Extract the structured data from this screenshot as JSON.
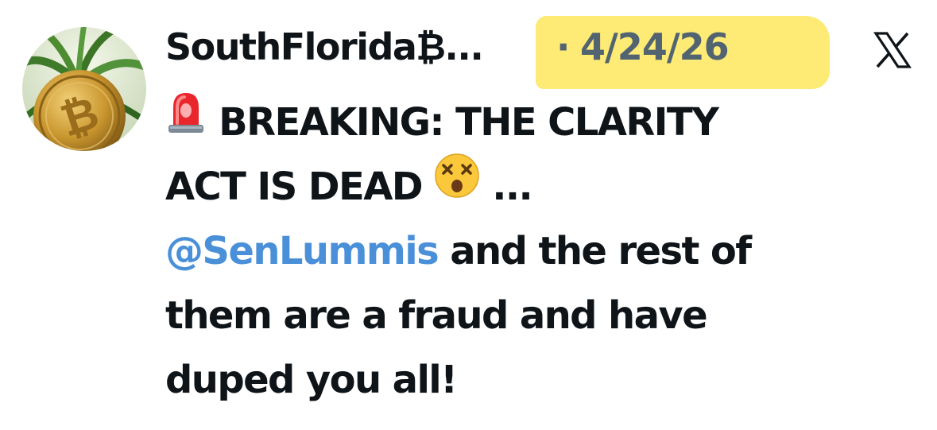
{
  "tweet": {
    "author": {
      "display_name": "SouthFlorida₿...",
      "avatar_icon": "bitcoin-palm-avatar"
    },
    "separator": "·",
    "date": "4/24/26",
    "date_highlight_color": "#fde96a",
    "platform_icon": "x-logo-icon",
    "lines": [
      {
        "emoji": "police-siren-emoji",
        "text": "BREAKING: THE CLARITY"
      },
      {
        "text_before": "ACT IS DEAD",
        "emoji": "dizzy-face-emoji",
        "text_after": "..."
      },
      {
        "mention": "@SenLummis",
        "text_after": "and the rest of"
      },
      {
        "text": "them are a fraud and have"
      },
      {
        "text": "duped you all!"
      }
    ],
    "mention_color": "#4a90d9"
  }
}
